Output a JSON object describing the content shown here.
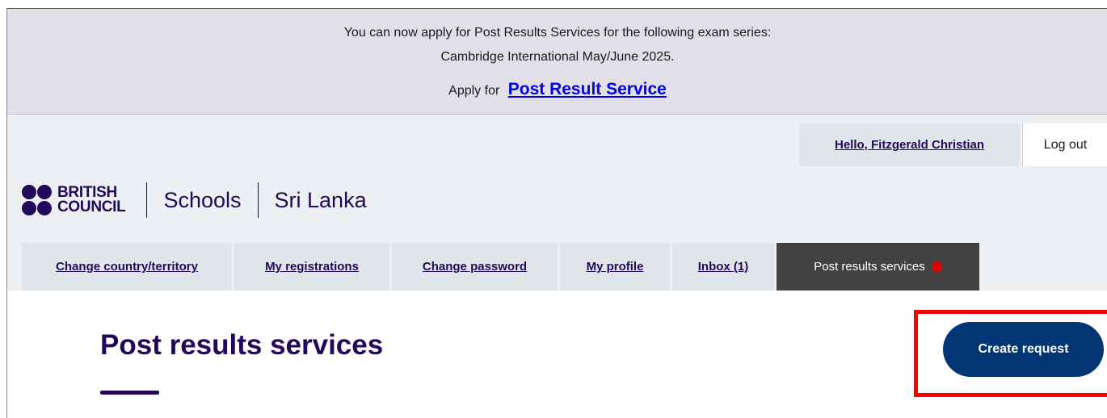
{
  "banner": {
    "line1": "You can now apply for Post Results Services for the following exam series:",
    "line2": "Cambridge International May/June 2025.",
    "apply_prefix": "Apply for",
    "apply_link": "Post Result Service"
  },
  "header": {
    "user_greeting": "Hello, Fitzgerald Christian",
    "logout_label": "Log out",
    "logo_line1": "BRITISH",
    "logo_line2": "COUNCIL",
    "brand_section": "Schools",
    "brand_country": "Sri Lanka"
  },
  "nav": {
    "items": [
      {
        "label": "Change country/territory"
      },
      {
        "label": "My registrations"
      },
      {
        "label": "Change password"
      },
      {
        "label": "My profile"
      },
      {
        "label": "Inbox (1)"
      },
      {
        "label": "Post results services",
        "active": true,
        "notification": true
      }
    ]
  },
  "main": {
    "title": "Post results services",
    "create_button": "Create request"
  },
  "colors": {
    "brand_navy": "#23085a",
    "button_blue": "#023574",
    "banner_bg": "#e2dfe9",
    "active_tab": "#424242",
    "notification_red": "#e60000",
    "highlight_red": "#ff0000"
  }
}
